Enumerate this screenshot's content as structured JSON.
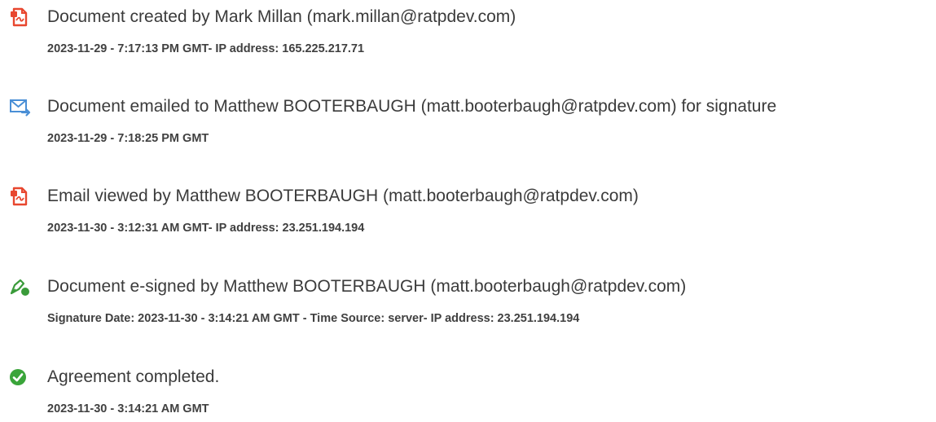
{
  "events": [
    {
      "icon": "document-icon",
      "title": "Document created by Mark Millan (mark.millan@ratpdev.com)",
      "detail": "2023-11-29 - 7:17:13 PM GMT- IP address: 165.225.217.71"
    },
    {
      "icon": "email-sent-icon",
      "title": "Document emailed to Matthew BOOTERBAUGH (matt.booterbaugh@ratpdev.com) for signature",
      "detail": "2023-11-29 - 7:18:25 PM GMT"
    },
    {
      "icon": "document-icon",
      "title": "Email viewed by Matthew BOOTERBAUGH (matt.booterbaugh@ratpdev.com)",
      "detail": "2023-11-30 - 3:12:31 AM GMT- IP address: 23.251.194.194"
    },
    {
      "icon": "e-sign-pen-icon",
      "title": "Document e-signed by Matthew BOOTERBAUGH (matt.booterbaugh@ratpdev.com)",
      "detail": "Signature Date: 2023-11-30 - 3:14:21 AM GMT - Time Source: server- IP address: 23.251.194.194"
    },
    {
      "icon": "check-circle-icon",
      "title": "Agreement completed.",
      "detail": "2023-11-30 - 3:14:21 AM GMT"
    }
  ],
  "colors": {
    "document_icon": "#e8472f",
    "email_icon": "#4a8fd6",
    "sign_icon": "#3a9b3a",
    "check_icon": "#3aa53a"
  }
}
